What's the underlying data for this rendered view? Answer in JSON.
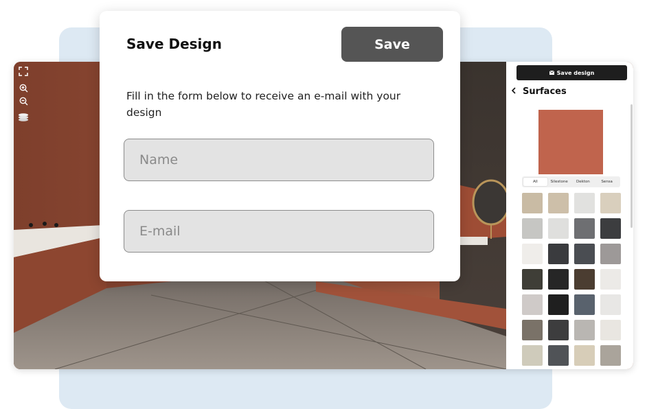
{
  "modal": {
    "title": "Save Design",
    "save_label": "Save",
    "description": "Fill in the form below to receive an e-mail with your design",
    "name_placeholder": "Name",
    "email_placeholder": "E-mail"
  },
  "viewer_toolbar": {
    "icons": [
      "fullscreen-icon",
      "zoom-in-icon",
      "zoom-out-icon",
      "layers-icon"
    ]
  },
  "side_panel": {
    "save_label": "Save design",
    "save_icon": "envelope-icon",
    "section_title": "Surfaces",
    "back_icon": "chevron-left-icon",
    "selected_color": "#c0644d",
    "tabs": [
      "All",
      "Silestone",
      "Dekton",
      "Sensa"
    ],
    "active_tab": "All",
    "swatches": [
      "#c9bba4",
      "#cdbfa9",
      "#e1e1df",
      "#d9cfbd",
      "#c6c6c3",
      "#dfdfdd",
      "#6e6f72",
      "#3c3d3f",
      "#efedea",
      "#3a3b3e",
      "#4a4d52",
      "#9d9998",
      "#3f3e37",
      "#262626",
      "#4b3d31",
      "#eceae7",
      "#cfcac8",
      "#1f1f1f",
      "#59626d",
      "#e8e7e5",
      "#7a7268",
      "#3d3d3e",
      "#b9b6b2",
      "#e9e6e1",
      "#cfcbbb",
      "#505357",
      "#d7cdb8",
      "#aaa49b"
    ]
  },
  "colors": {
    "accent_dark": "#555555",
    "input_bg": "#e3e3e3",
    "background_panel": "#dde9f3"
  }
}
